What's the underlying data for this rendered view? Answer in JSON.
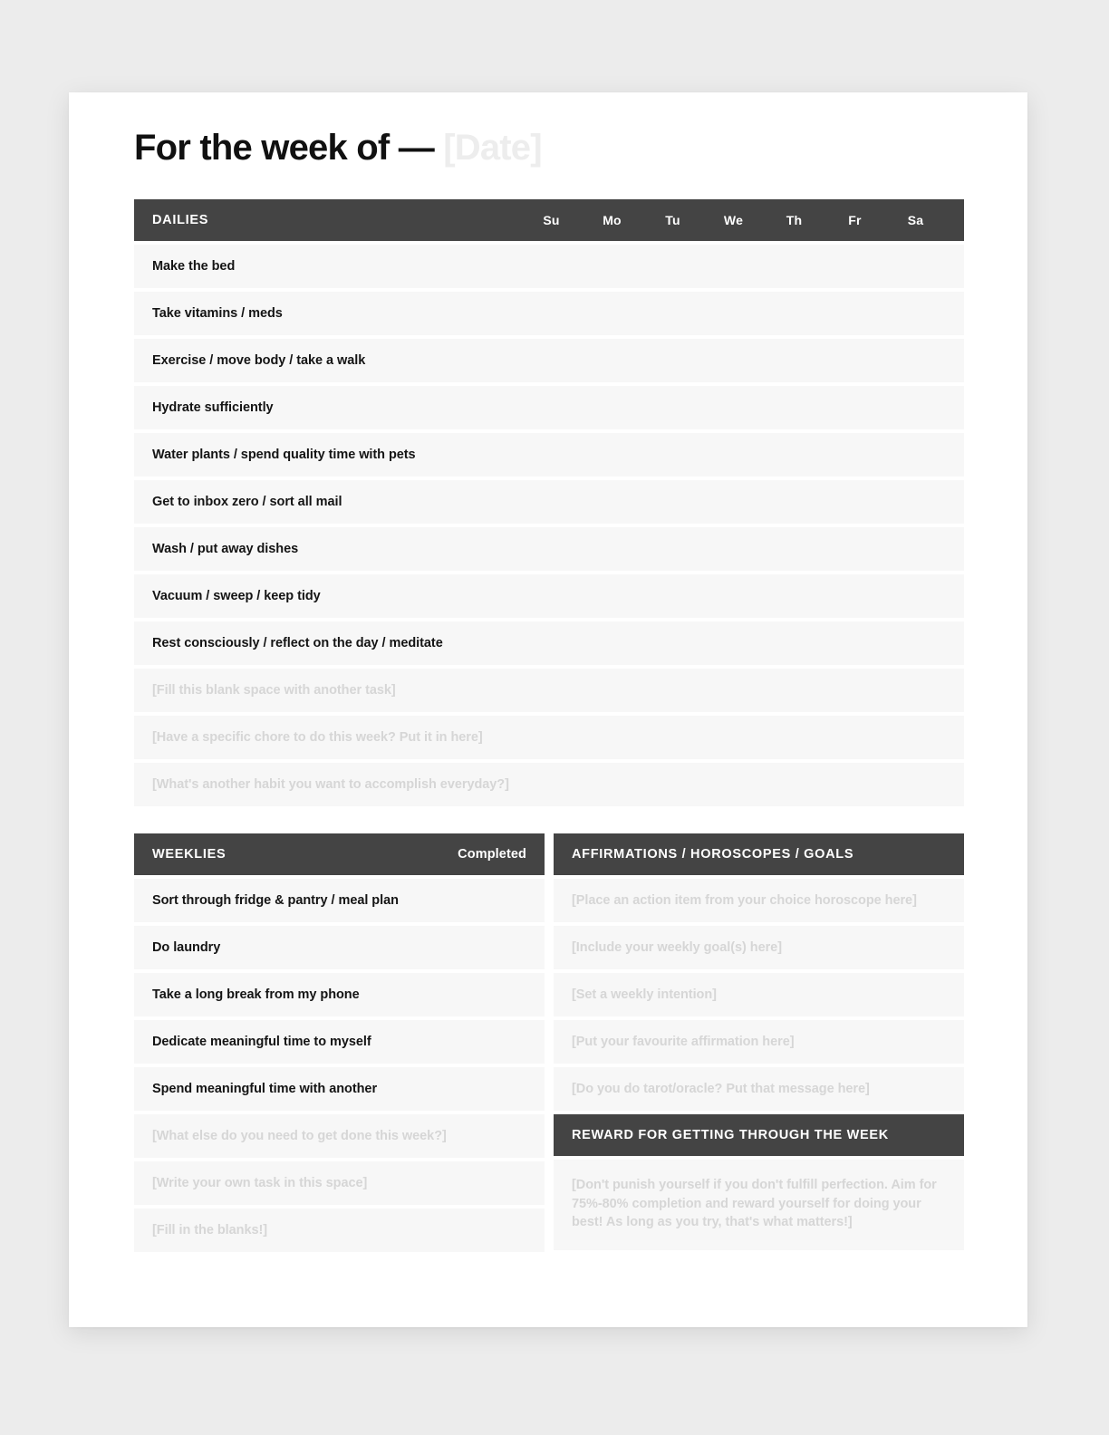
{
  "title": {
    "prefix": "For the week of —",
    "date_placeholder": "[Date]"
  },
  "dailies": {
    "header": "DAILIES",
    "days": [
      "Su",
      "Mo",
      "Tu",
      "We",
      "Th",
      "Fr",
      "Sa"
    ],
    "tasks": [
      "Make the bed",
      "Take vitamins / meds",
      "Exercise / move body / take a walk",
      "Hydrate sufficiently",
      "Water plants / spend quality time with pets",
      "Get to inbox zero / sort all mail",
      "Wash / put away dishes",
      "Vacuum / sweep / keep tidy",
      "Rest consciously / reflect on the day / meditate"
    ],
    "placeholders": [
      "[Fill this blank space with another task]",
      "[Have a specific chore to do this week? Put it in here]",
      "[What's another habit you want to accomplish everyday?]"
    ]
  },
  "weeklies": {
    "header": "WEEKLIES",
    "completed_label": "Completed",
    "tasks": [
      "Sort through fridge & pantry / meal plan",
      "Do laundry",
      "Take a long break from my phone",
      "Dedicate meaningful time to myself",
      "Spend meaningful time with another"
    ],
    "placeholders": [
      "[What else do you need to get done this week?]",
      "[Write your own task in this space]",
      "[Fill in the blanks!]"
    ]
  },
  "affirmations": {
    "header": "AFFIRMATIONS / HOROSCOPES / GOALS",
    "placeholders": [
      "[Place an action item from your choice horoscope here]",
      "[Include your weekly goal(s) here]",
      "[Set a weekly intention]",
      "[Put your favourite affirmation here]",
      "[Do you do tarot/oracle? Put that message here]"
    ]
  },
  "reward": {
    "header": "REWARD FOR GETTING THROUGH THE WEEK",
    "text": "[Don't punish yourself if you don't fulfill perfection. Aim for 75%-80% completion and reward yourself for doing your best! As long as you try, that's what matters!]"
  },
  "colors": {
    "header_bar": "#444444",
    "row_fill": "#f7f7f7",
    "placeholder_text": "#d6d6d6",
    "page_background": "#ffffff",
    "canvas_background": "#ececec",
    "title_text": "#111111"
  }
}
